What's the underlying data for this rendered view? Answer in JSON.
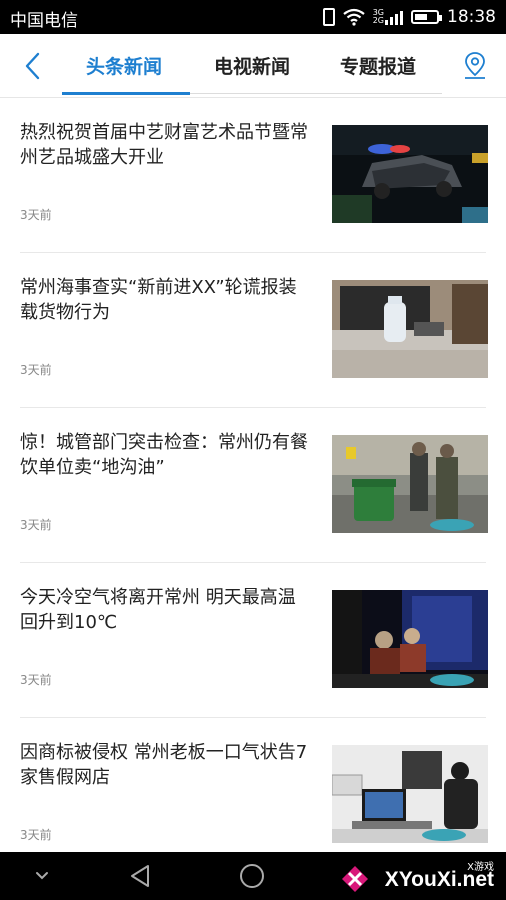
{
  "status_bar": {
    "carrier": "中国电信",
    "time": "18:38",
    "net_top": "3G",
    "net_bottom": "2G"
  },
  "header": {
    "tabs": [
      {
        "label": "头条新闻",
        "active": true
      },
      {
        "label": "电视新闻",
        "active": false
      },
      {
        "label": "专题报道",
        "active": false
      }
    ],
    "accent_color": "#1e7fd0",
    "icons": {
      "back": "back-chevron-icon",
      "location": "location-pin-icon"
    }
  },
  "news": [
    {
      "title": "热烈祝贺首届中艺财富艺术品节暨常州艺品城盛大开业",
      "time": "3天前"
    },
    {
      "title": "常州海事查实“新前进XX”轮谎报装载货物行为",
      "time": "3天前"
    },
    {
      "title": "惊！城管部门突击检查：常州仍有餐饮单位卖“地沟油”",
      "time": "3天前"
    },
    {
      "title": "今天冷空气将离开常州 明天最高温回升到10℃",
      "time": "3天前"
    },
    {
      "title": "因商标被侵权 常州老板一口气状告7家售假网店",
      "time": "3天前"
    }
  ],
  "nav_bar": {
    "icons": [
      "down-chevron-icon",
      "back-triangle-icon",
      "home-circle-icon"
    ]
  },
  "watermark": {
    "small": "X游戏",
    "big": "XYouXi.net"
  }
}
